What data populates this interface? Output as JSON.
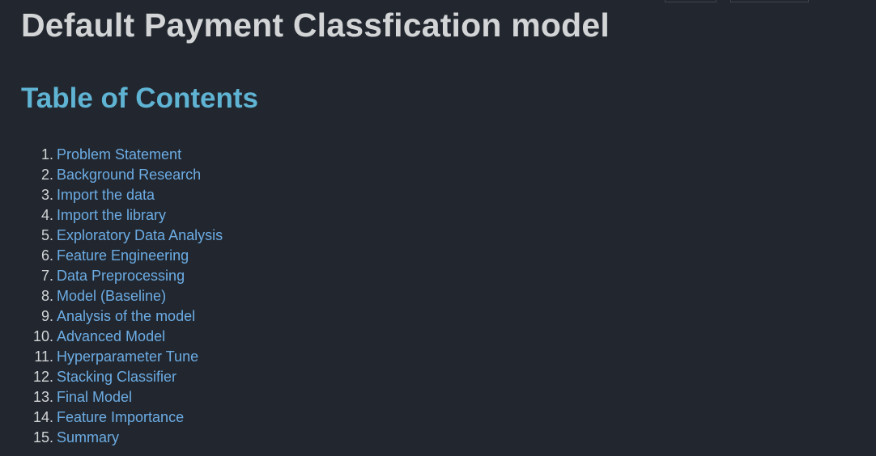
{
  "document": {
    "title": "Default Payment Classfication model",
    "toc_heading": "Table of Contents",
    "toc": [
      {
        "number": "1.",
        "label": "Problem Statement"
      },
      {
        "number": "2.",
        "label": "Background Research"
      },
      {
        "number": "3.",
        "label": "Import the data"
      },
      {
        "number": "4.",
        "label": "Import the library"
      },
      {
        "number": "5.",
        "label": "Exploratory Data Analysis"
      },
      {
        "number": "6.",
        "label": "Feature Engineering"
      },
      {
        "number": "7.",
        "label": "Data Preprocessing"
      },
      {
        "number": "8.",
        "label": "Model (Baseline)"
      },
      {
        "number": "9.",
        "label": "Analysis of the model"
      },
      {
        "number": "10.",
        "label": "Advanced Model"
      },
      {
        "number": "11.",
        "label": "Hyperparameter Tune"
      },
      {
        "number": "12.",
        "label": "Stacking Classifier"
      },
      {
        "number": "13.",
        "label": "Final Model"
      },
      {
        "number": "14.",
        "label": "Feature Importance"
      },
      {
        "number": "15.",
        "label": "Summary"
      }
    ]
  },
  "colors": {
    "background": "#22272f",
    "title_text": "#d2d4d6",
    "heading_accent": "#5fb3d3",
    "link": "#6cace4"
  }
}
